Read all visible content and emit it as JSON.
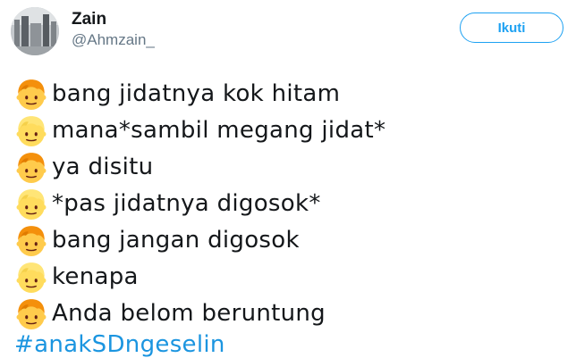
{
  "user": {
    "display_name": "Zain",
    "handle": "@Ahmzain_",
    "avatar_icon": "profile-photo"
  },
  "follow_button": {
    "label": "Ikuti",
    "accent_color": "#1da1f2"
  },
  "tweet": {
    "lines": [
      {
        "speaker_icon": "boy-emoji-orange-hair",
        "text": "bang jidatnya kok hitam"
      },
      {
        "speaker_icon": "boy-emoji-blond-hair",
        "text": "mana*sambil megang jidat*"
      },
      {
        "speaker_icon": "boy-emoji-orange-hair",
        "text": "ya disitu"
      },
      {
        "speaker_icon": "boy-emoji-blond-hair",
        "text": "*pas jidatnya digosok*"
      },
      {
        "speaker_icon": "boy-emoji-orange-hair",
        "text": "bang jangan digosok"
      },
      {
        "speaker_icon": "boy-emoji-blond-hair",
        "text": "kenapa"
      },
      {
        "speaker_icon": "boy-emoji-orange-hair",
        "text": "Anda belom beruntung"
      }
    ],
    "hashtag": "#anakSDngeselin",
    "hashtag_color": "#1b95e0"
  }
}
